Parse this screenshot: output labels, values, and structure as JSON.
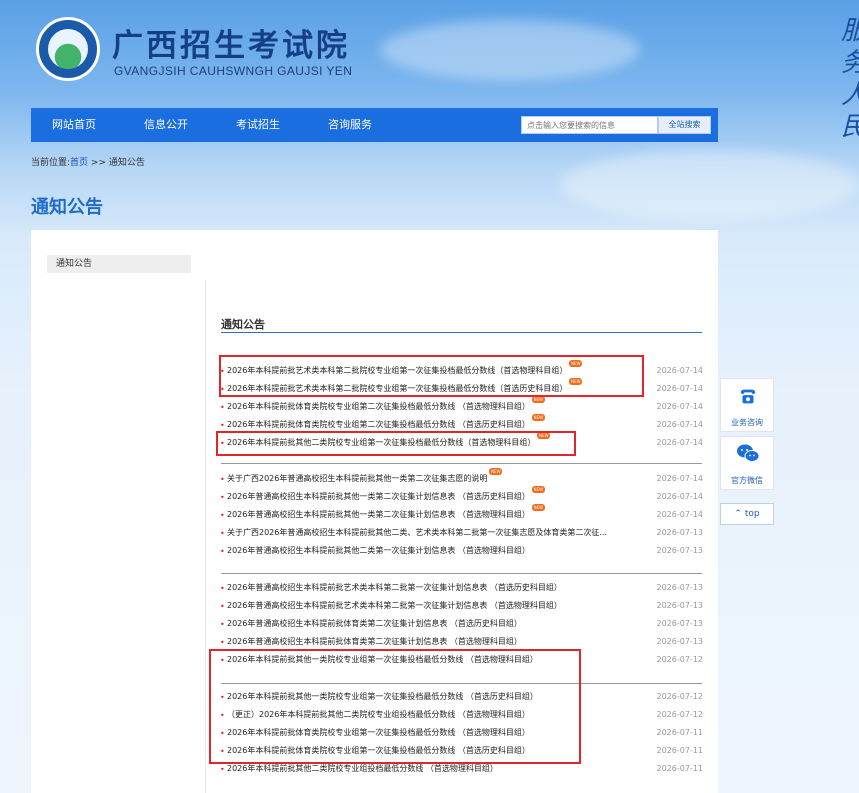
{
  "header": {
    "site_name": "广西招生考试院",
    "site_subtitle": "GVANGJSIH CAUHSWNGH GAUJSI YEN",
    "deco_text": "服务人民"
  },
  "nav": {
    "items": [
      "网站首页",
      "信息公开",
      "考试招生",
      "咨询服务"
    ],
    "search_placeholder": "点击输入您要搜索的信息",
    "search_button": "全站搜索"
  },
  "breadcrumb": {
    "prefix": "当前位置:",
    "home": "首页",
    "separator": " >> ",
    "current": "通知公告"
  },
  "page_title": "通知公告",
  "sidebar": {
    "tab": "通知公告"
  },
  "list": {
    "heading": "通知公告",
    "badge_text": "NEW",
    "groups": [
      [
        {
          "title": "2026年本科提前批艺术类本科第二批院校专业组第一次征集投档最低分数线（首选物理科目组）",
          "date": "2026-07-14",
          "new": true
        },
        {
          "title": "2026年本科提前批艺术类本科第二批院校专业组第一次征集投档最低分数线（首选历史科目组）",
          "date": "2026-07-14",
          "new": true
        },
        {
          "title": "2026年本科提前批体育类院校专业组第二次征集投档最低分数线 （首选物理科目组）",
          "date": "2026-07-14",
          "new": true
        },
        {
          "title": "2026年本科提前批体育类院校专业组第二次征集投档最低分数线 （首选历史科目组）",
          "date": "2026-07-14",
          "new": true
        },
        {
          "title": "2026年本科提前批其他二类院校专业组第一次征集投档最低分数线（首选物理科目组）",
          "date": "2026-07-14",
          "new": true
        }
      ],
      [
        {
          "title": "关于广西2026年普通高校招生本科提前批其他一类第二次征集志愿的说明",
          "date": "2026-07-14",
          "new": true
        },
        {
          "title": "2026年普通高校招生本科提前批其他一类第二次征集计划信息表 （首选历史科目组）",
          "date": "2026-07-14",
          "new": true
        },
        {
          "title": "2026年普通高校招生本科提前批其他一类第二次征集计划信息表 （首选物理科目组）",
          "date": "2026-07-14",
          "new": true
        },
        {
          "title": "关于广西2026年普通高校招生本科提前批其他二类、艺术类本科第二批第一次征集志愿及体育类第二次征...",
          "date": "2026-07-13",
          "new": false
        },
        {
          "title": "2026年普通高校招生本科提前批其他二类第一次征集计划信息表 （首选物理科目组）",
          "date": "2026-07-13",
          "new": false
        }
      ],
      [
        {
          "title": "2026年普通高校招生本科提前批艺术类本科第二批第一次征集计划信息表 （首选历史科目组）",
          "date": "2026-07-13",
          "new": false
        },
        {
          "title": "2026年普通高校招生本科提前批艺术类本科第二批第一次征集计划信息表 （首选物理科目组）",
          "date": "2026-07-13",
          "new": false
        },
        {
          "title": "2026年普通高校招生本科提前批体育类第二次征集计划信息表 （首选历史科目组）",
          "date": "2026-07-13",
          "new": false
        },
        {
          "title": "2026年普通高校招生本科提前批体育类第二次征集计划信息表 （首选物理科目组）",
          "date": "2026-07-13",
          "new": false
        },
        {
          "title": "2026年本科提前批其他一类院校专业组第一次征集投档最低分数线 （首选物理科目组）",
          "date": "2026-07-12",
          "new": false
        }
      ],
      [
        {
          "title": "2026年本科提前批其他一类院校专业组第一次征集投档最低分数线 （首选历史科目组）",
          "date": "2026-07-12",
          "new": false
        },
        {
          "title": "（更正）2026年本科提前批其他二类院校专业组投档最低分数线 （首选物理科目组）",
          "date": "2026-07-12",
          "new": false
        },
        {
          "title": "2026年本科提前批体育类院校专业组第一次征集投档最低分数线 （首选物理科目组）",
          "date": "2026-07-11",
          "new": false
        },
        {
          "title": "2026年本科提前批体育类院校专业组第一次征集投档最低分数线 （首选历史科目组）",
          "date": "2026-07-11",
          "new": false
        },
        {
          "title": "2026年本科提前批其他二类院校专业组投档最低分数线 （首选物理科目组）",
          "date": "2026-07-11",
          "new": false
        }
      ]
    ]
  },
  "float_panel": {
    "consult_label": "业务咨询",
    "wechat_label": "官方微信",
    "top_label": "top"
  },
  "colors": {
    "nav_blue": "#1b6ee0",
    "title_blue": "#1f6dc7",
    "highlight_red": "#e0262b",
    "badge_orange": "#f26b1d"
  },
  "icons": {
    "phone": "phone-icon",
    "wechat": "wechat-icon",
    "chevron_up": "chevron-up-icon"
  }
}
